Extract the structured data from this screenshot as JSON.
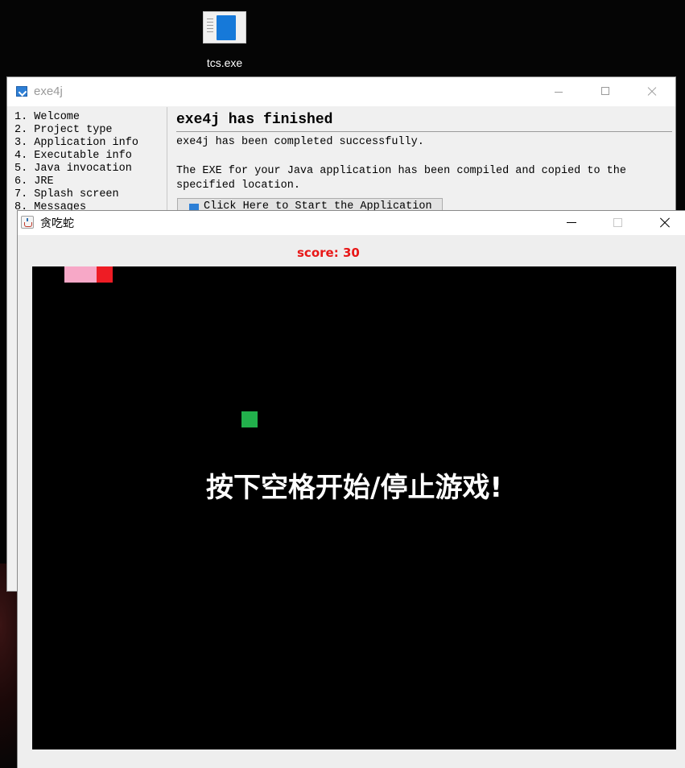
{
  "desktop": {
    "icon_label": "tcs.exe"
  },
  "exe4j": {
    "title": "exe4j",
    "steps": [
      "1. Welcome",
      "2. Project type",
      "3. Application info",
      "4. Executable info",
      "5. Java invocation",
      "6. JRE",
      "7. Splash screen",
      "8. Messages"
    ],
    "heading": "exe4j has finished",
    "line1": "exe4j has been completed successfully.",
    "line2": "The EXE for your Java application has been compiled and copied to the",
    "line3": "specified location.",
    "button_label": "Click Here to Start the Application"
  },
  "game": {
    "title": "贪吃蛇",
    "score_label": "score:",
    "score": 30,
    "message": "按下空格开始/停止游戏!",
    "colors": {
      "snake_head": "#ee1c24",
      "snake_body": "#f7a8c7",
      "food": "#22b14c",
      "board": "#000000",
      "score": "#e81717"
    }
  },
  "icons": [
    "file-icon",
    "exe4j-app-icon",
    "java-cup-icon",
    "minimize-icon",
    "maximize-icon",
    "close-icon"
  ]
}
